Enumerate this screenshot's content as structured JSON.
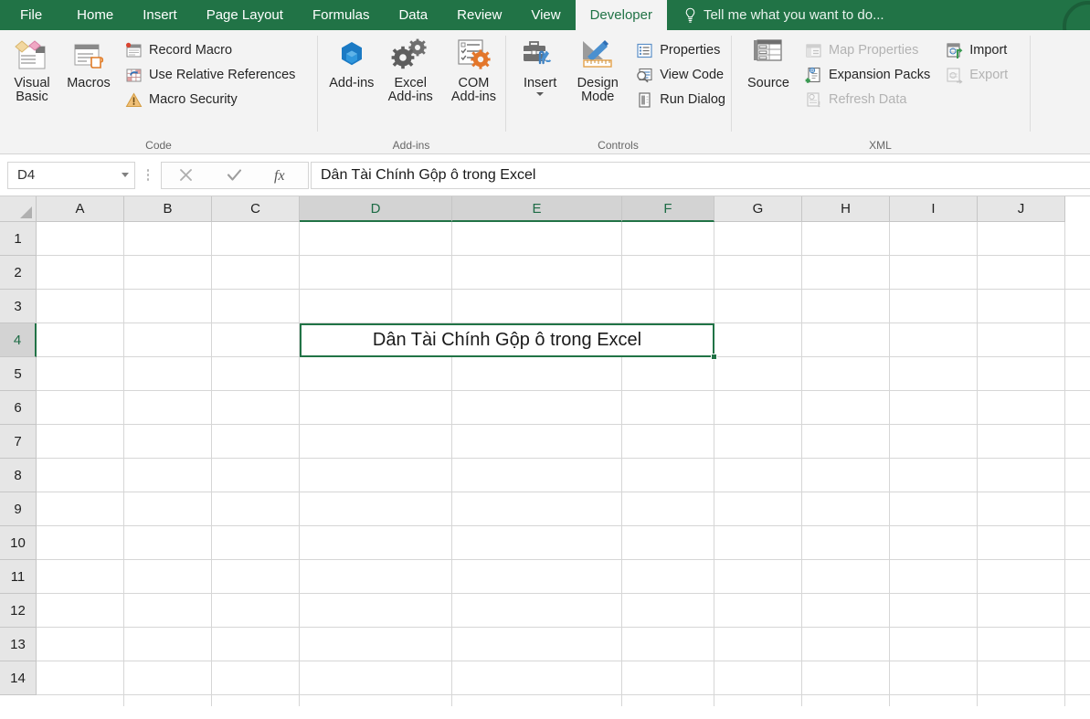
{
  "ribbon": {
    "tabs": [
      {
        "label": "File",
        "active": false
      },
      {
        "label": "Home",
        "active": false
      },
      {
        "label": "Insert",
        "active": false
      },
      {
        "label": "Page Layout",
        "active": false
      },
      {
        "label": "Formulas",
        "active": false
      },
      {
        "label": "Data",
        "active": false
      },
      {
        "label": "Review",
        "active": false
      },
      {
        "label": "View",
        "active": false
      },
      {
        "label": "Developer",
        "active": true
      }
    ],
    "tellme": {
      "label": "Tell me what you want to do...",
      "icon": "lightbulb-icon"
    },
    "avatar": {
      "icon": "account-avatar-icon"
    },
    "groups": [
      {
        "name": "Code",
        "label": "Code",
        "big": [
          {
            "label": "Visual Basic",
            "icon": "visual-basic-icon",
            "disabled": false
          },
          {
            "label": "Macros",
            "icon": "macros-icon",
            "disabled": false
          }
        ],
        "small": [
          {
            "label": "Record Macro",
            "icon": "record-macro-icon",
            "disabled": false
          },
          {
            "label": "Use Relative References",
            "icon": "relative-references-icon",
            "disabled": false
          },
          {
            "label": "Macro Security",
            "icon": "macro-security-icon",
            "disabled": false
          }
        ]
      },
      {
        "name": "Add-ins",
        "label": "Add-ins",
        "big": [
          {
            "label": "Add-ins",
            "icon": "addins-icon",
            "disabled": false
          },
          {
            "label": "Excel Add-ins",
            "icon": "excel-addins-icon",
            "disabled": false
          },
          {
            "label": "COM Add-ins",
            "icon": "com-addins-icon",
            "disabled": false
          }
        ],
        "small": []
      },
      {
        "name": "Controls",
        "label": "Controls",
        "big": [
          {
            "label": "Insert",
            "icon": "insert-control-icon",
            "disabled": false,
            "dropdown": true
          },
          {
            "label": "Design Mode",
            "icon": "design-mode-icon",
            "disabled": false
          }
        ],
        "small": [
          {
            "label": "Properties",
            "icon": "properties-icon",
            "disabled": false
          },
          {
            "label": "View Code",
            "icon": "view-code-icon",
            "disabled": false
          },
          {
            "label": "Run Dialog",
            "icon": "run-dialog-icon",
            "disabled": false
          }
        ]
      },
      {
        "name": "XML",
        "label": "XML",
        "big": [
          {
            "label": "Source",
            "icon": "xml-source-icon",
            "disabled": false
          }
        ],
        "small": [
          {
            "label": "Map Properties",
            "icon": "map-properties-icon",
            "disabled": true
          },
          {
            "label": "Expansion Packs",
            "icon": "expansion-packs-icon",
            "disabled": false
          },
          {
            "label": "Refresh Data",
            "icon": "refresh-data-icon",
            "disabled": true
          }
        ],
        "small2": [
          {
            "label": "Import",
            "icon": "import-icon",
            "disabled": false
          },
          {
            "label": "Export",
            "icon": "export-icon",
            "disabled": true
          }
        ]
      }
    ]
  },
  "formula_bar": {
    "name_box_value": "D4",
    "name_box_placeholder": "Name Box",
    "cancel_icon": "cancel-x-icon",
    "enter_icon": "enter-check-icon",
    "function_icon": "insert-function-fx-icon",
    "value": "Dân Tài Chính Gộp ô trong Excel",
    "placeholder": ""
  },
  "grid": {
    "columns": [
      {
        "label": "A",
        "width": 96,
        "selected": false
      },
      {
        "label": "B",
        "width": 96,
        "selected": false
      },
      {
        "label": "C",
        "width": 96,
        "selected": false
      },
      {
        "label": "D",
        "width": 167,
        "selected": true
      },
      {
        "label": "E",
        "width": 186,
        "selected": true
      },
      {
        "label": "F",
        "width": 101,
        "selected": true
      },
      {
        "label": "G",
        "width": 96,
        "selected": false
      },
      {
        "label": "H",
        "width": 96,
        "selected": false
      },
      {
        "label": "I",
        "width": 96,
        "selected": false
      },
      {
        "label": "J",
        "width": 96,
        "selected": false
      }
    ],
    "rows": [
      {
        "label": "1",
        "selected": false
      },
      {
        "label": "2",
        "selected": false
      },
      {
        "label": "3",
        "selected": false
      },
      {
        "label": "4",
        "selected": true
      },
      {
        "label": "5",
        "selected": false
      },
      {
        "label": "6",
        "selected": false
      },
      {
        "label": "7",
        "selected": false
      },
      {
        "label": "8",
        "selected": false
      },
      {
        "label": "9",
        "selected": false
      },
      {
        "label": "10",
        "selected": false
      },
      {
        "label": "11",
        "selected": false
      },
      {
        "label": "12",
        "selected": false
      },
      {
        "label": "13",
        "selected": false
      },
      {
        "label": "14",
        "selected": false
      }
    ],
    "active_cell": {
      "reference": "D4",
      "value": "Dân Tài Chính Gộp ô trong Excel",
      "merged_range": "D4:F4",
      "start_col_index": 3,
      "end_col_index": 5,
      "row_index": 3,
      "align": "center"
    }
  },
  "colors": {
    "brand_green": "#217346",
    "tab_active_bg": "#f3f3f3",
    "ribbon_bg": "#f3f3f3",
    "header_bg": "#e6e6e6",
    "header_selected_bg": "#d3d3d3",
    "gridline": "#d6d6d6",
    "disabled_text": "#b3b3b3"
  }
}
